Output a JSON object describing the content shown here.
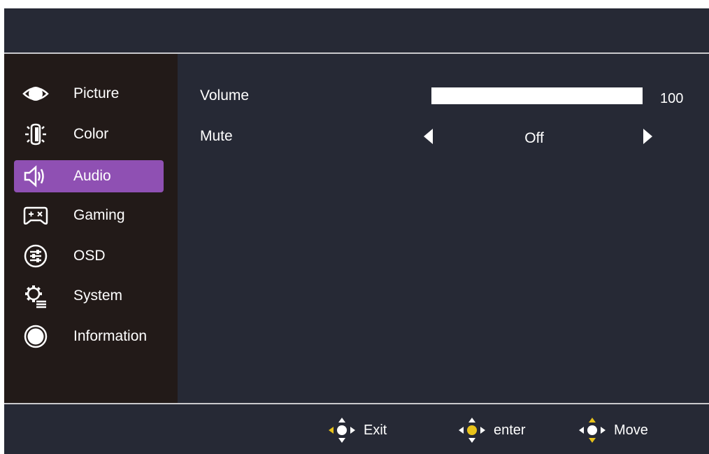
{
  "menu": [
    {
      "label": "Picture",
      "icon": "eye-icon",
      "active": false
    },
    {
      "label": "Color",
      "icon": "color-bulb-icon",
      "active": false
    },
    {
      "label": "Audio",
      "icon": "speaker-icon",
      "active": true
    },
    {
      "label": "Gaming",
      "icon": "gamepad-icon",
      "active": false
    },
    {
      "label": "OSD",
      "icon": "osd-sliders-icon",
      "active": false
    },
    {
      "label": "System",
      "icon": "system-gear-icon",
      "active": false
    },
    {
      "label": "Information",
      "icon": "info-circle-icon",
      "active": false
    }
  ],
  "audio": {
    "volume_label": "Volume",
    "volume_value": "100",
    "volume_level": 1.0,
    "mute_label": "Mute",
    "mute_value": "Off"
  },
  "footer": {
    "exit_label": "Exit",
    "enter_label": "enter",
    "move_label": "Move"
  },
  "colors": {
    "background": "#262935",
    "sidebar": "#221a18",
    "active_item": "#8f50b3",
    "hint_highlight": "#e8c21a",
    "text": "#ffffff"
  }
}
